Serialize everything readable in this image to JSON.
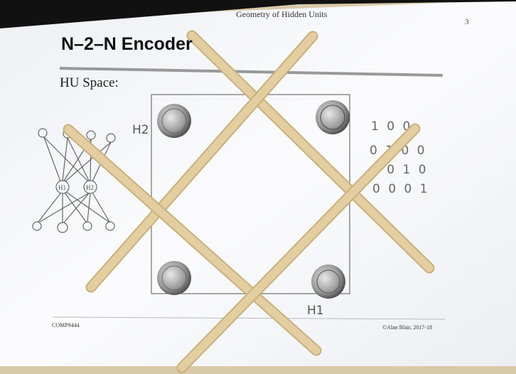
{
  "slide": {
    "running_title": "Geometry of Hidden Units",
    "page_number": "3",
    "title": "N–2–N Encoder",
    "subtitle": "HU Space:",
    "footer_left": "COMP9444",
    "footer_right": "©Alan Blair, 2017-18"
  },
  "handwriting": {
    "axis_y": "H2",
    "axis_x": "H1",
    "hidden_unit_1": "H1",
    "hidden_unit_2": "H2",
    "codes": [
      "1 0 0",
      "0 1 0 0",
      "0 0 1 0",
      "0 0 0 1"
    ]
  },
  "colors": {
    "stick": "#dcc79a",
    "paper": "#f7f8fa",
    "table": "#d8c9a8"
  }
}
